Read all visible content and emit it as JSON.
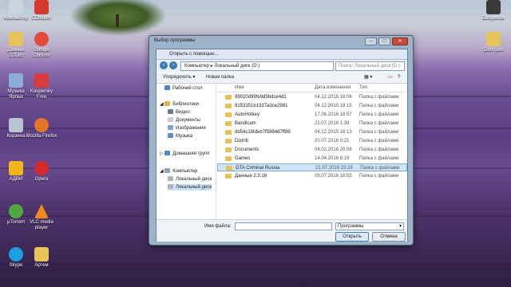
{
  "desktop": {
    "icons": [
      {
        "name": "Компьютер",
        "icon": "computer-icon",
        "color": "#c9d4de"
      },
      {
        "name": "CCleaner",
        "icon": "ccleaner-icon",
        "color": "#d6382c"
      },
      {
        "name": "Данные 2.3.16",
        "icon": "folder-icon",
        "color": "#e6c45a"
      },
      {
        "name": "Google Chrome",
        "icon": "chrome-icon",
        "color": "#e24b3b"
      },
      {
        "name": "Музыка Ярлык",
        "icon": "music-icon",
        "color": "#8bb0d8"
      },
      {
        "name": "Kaspersky Free",
        "icon": "kaspersky-icon",
        "color": "#d93b3b"
      },
      {
        "name": "Корзина",
        "icon": "recycle-bin-icon",
        "color": "#b8c4cf"
      },
      {
        "name": "Mozilla Firefox",
        "icon": "firefox-icon",
        "color": "#e6732a"
      },
      {
        "name": "АДВИ",
        "icon": "adwcleaner-icon",
        "color": "#f2b51a"
      },
      {
        "name": "Opera",
        "icon": "opera-icon",
        "color": "#d22b2b"
      },
      {
        "name": "µTorrent",
        "icon": "utorrent-icon",
        "color": "#4fa83d"
      },
      {
        "name": "VLC media player",
        "icon": "vlc-icon",
        "color": "#f08a1c"
      },
      {
        "name": "Skype",
        "icon": "skype-icon",
        "color": "#1c9fe0"
      },
      {
        "name": "Артем",
        "icon": "folder-icon",
        "color": "#e6c45a"
      },
      {
        "name": "Бандикам",
        "icon": "bandicam-icon",
        "color": "#3a3a3a"
      },
      {
        "name": "Dark Leo",
        "icon": "folder-icon",
        "color": "#e6c45a"
      }
    ]
  },
  "dialog": {
    "title": "Выбор программы",
    "subtitle": "Открыть с помощью...",
    "address": {
      "crumbs": [
        "Компьютер",
        "Локальный диск (D:)"
      ],
      "search_placeholder": "Поиск: Локальный диск (D:)"
    },
    "toolbar": {
      "organize": "Упорядочить ▾",
      "new_folder": "Новая папка"
    },
    "nav": {
      "desktop": "Рабочий стол",
      "libraries": "Библиотеки",
      "video": "Видео",
      "documents": "Документы",
      "images": "Изображения",
      "music": "Музыка",
      "homegroup": "Домашняя групп",
      "computer": "Компьютер",
      "local_c": "Локальный диск",
      "local_d": "Локальный диск"
    },
    "columns": {
      "name": "Имя",
      "date": "Дата изменения",
      "type": "Тип"
    },
    "files": [
      {
        "name": "99020d99fe9d5bdce4d1",
        "date": "04.12.2015 18:06",
        "type": "Папка с файлами"
      },
      {
        "name": "8153351b1337a3ce2981",
        "date": "04.12.2015 18:15",
        "type": "Папка с файлами"
      },
      {
        "name": "AutoHotkey",
        "date": "17.06.2016 18:57",
        "type": "Папка с файлами"
      },
      {
        "name": "Bandicam",
        "date": "22.07.2016 1:39",
        "type": "Папка с файлами"
      },
      {
        "name": "db54c16fdeb7f5984d7ff89",
        "date": "04.12.2015 18:13",
        "type": "Папка с файлами"
      },
      {
        "name": "Distrib",
        "date": "20.07.2016 0:21",
        "type": "Папка с файлами"
      },
      {
        "name": "Documents",
        "date": "04.02.2016 20:08",
        "type": "Папка с файлами"
      },
      {
        "name": "Games",
        "date": "14.04.2016 8:19",
        "type": "Папка с файлами"
      },
      {
        "name": "GTA Criminal Russia",
        "date": "21.07.2016 23:29",
        "type": "Папка с файлами"
      },
      {
        "name": "Данные 2.3.16",
        "date": "09.07.2016 16:55",
        "type": "Папка с файлами"
      }
    ],
    "selected_index": 8,
    "footer": {
      "filename_label": "Имя файла:",
      "filename_value": "",
      "filetype": "Программы",
      "open": "Открыть",
      "cancel": "Отмена"
    },
    "colors": {
      "accent": "#3e78b8",
      "selection": "#cde4fb",
      "folder": "#e7c255",
      "close": "#c94b3d"
    }
  }
}
